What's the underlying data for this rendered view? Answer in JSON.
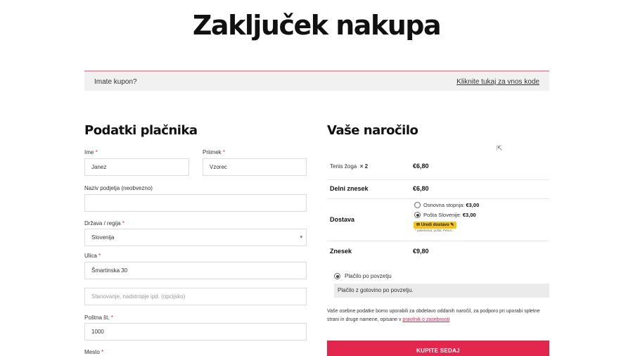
{
  "page": {
    "title": "Zaključek nakupa"
  },
  "coupon": {
    "question": "Imate kupon?",
    "link": "Kliknite tukaj za vnos kode"
  },
  "billing": {
    "heading": "Podatki plačnika",
    "first_name": {
      "label": "Ime",
      "value": "Janez"
    },
    "last_name": {
      "label": "Priimek",
      "value": "Vzorec"
    },
    "company": {
      "label": "Naziv podjetja (neobvezno)",
      "value": ""
    },
    "country": {
      "label": "Država / regija",
      "value": "Slovenija"
    },
    "street": {
      "label": "Ulica",
      "value": "Šmartinska 30"
    },
    "apartment": {
      "placeholder": "Stanovanje, nadstropje ipd. (opcijsko)"
    },
    "postcode": {
      "label": "Poštna št.",
      "value": "1000"
    },
    "city": {
      "label": "Mesto"
    },
    "required_mark": "*"
  },
  "order": {
    "heading": "Vaše naročilo",
    "item": {
      "name": "Tenis žoga",
      "qty": "× 2",
      "price": "€6,80"
    },
    "subtotal": {
      "label": "Delni znesek",
      "value": "€6,80"
    },
    "shipping": {
      "label": "Dostava",
      "options": [
        {
          "name": "Osnovna stopnja:",
          "price": "€3,00",
          "selected": false
        },
        {
          "name": "Pošta Slovenije:",
          "price": "€3,00",
          "selected": true
        }
      ],
      "badge": "Uredi dostavo",
      "badge_note": "* paketomat, pošta, Petrol..."
    },
    "total": {
      "label": "Znesek",
      "value": "€9,80"
    }
  },
  "payment": {
    "method": "Plačilo po povzetju",
    "description": "Plačilo z gotovino po povzetju.",
    "privacy_text": "Vaše osebne podatke bomo uporabili za obdelavo oddanih naročil, za podporo pri uporabi spletne strani in druge namene, opisane v",
    "privacy_link": "pravilnik o zasebnosti",
    "submit": "KUPITE SEDAJ"
  }
}
